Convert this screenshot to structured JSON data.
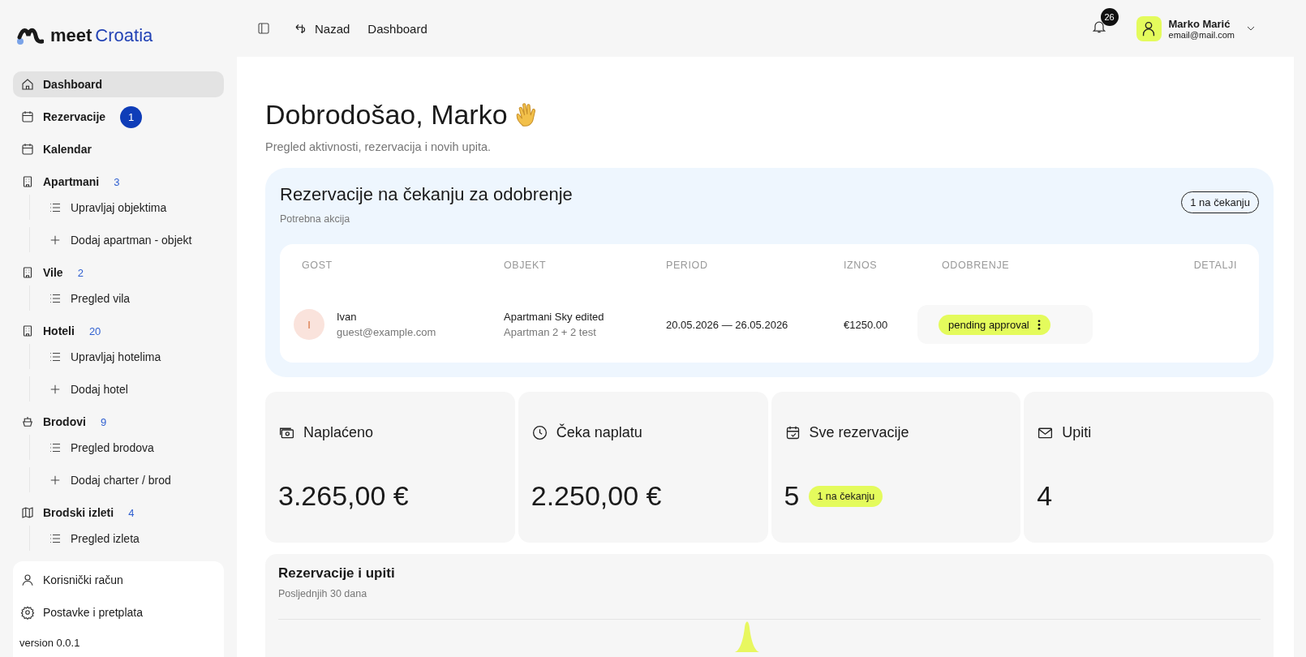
{
  "brand": {
    "mark": "meet",
    "name": "Croatia"
  },
  "sidebar": {
    "items": [
      {
        "label": "Dashboard",
        "selected": true
      },
      {
        "label": "Rezervacije",
        "selected": false,
        "badge": "1"
      },
      {
        "label": "Kalendar",
        "selected": false
      },
      {
        "label": "Apartmani",
        "selected": false,
        "count": "3",
        "children": [
          {
            "label": "Upravljaj objektima",
            "kind": "list"
          },
          {
            "label": "Dodaj apartman - objekt",
            "kind": "add"
          }
        ]
      },
      {
        "label": "Vile",
        "selected": false,
        "count": "2",
        "children": [
          {
            "label": "Pregled vila",
            "kind": "list"
          }
        ]
      },
      {
        "label": "Hoteli",
        "selected": false,
        "count": "20",
        "children": [
          {
            "label": "Upravljaj hotelima",
            "kind": "list"
          },
          {
            "label": "Dodaj hotel",
            "kind": "add"
          }
        ]
      },
      {
        "label": "Brodovi",
        "selected": false,
        "count": "9",
        "children": [
          {
            "label": "Pregled brodova",
            "kind": "list"
          },
          {
            "label": "Dodaj charter / brod",
            "kind": "add"
          }
        ]
      },
      {
        "label": "Brodski izleti",
        "selected": false,
        "count": "4",
        "children": [
          {
            "label": "Pregled izleta",
            "kind": "list"
          }
        ]
      }
    ]
  },
  "account_menu": {
    "items": [
      {
        "label": "Korisnički račun"
      },
      {
        "label": "Postavke i pretplata"
      }
    ],
    "version": "version 0.0.1"
  },
  "topbar": {
    "back": "Nazad",
    "breadcrumb": "Dashboard",
    "notifications": "26",
    "user": {
      "name": "Marko Marić",
      "email": "email@mail.com"
    }
  },
  "welcome": {
    "title": "Dobrodošao, Marko",
    "subtitle": "Pregled aktivnosti, rezervacija i novih upita."
  },
  "pending": {
    "title": "Rezervacije na čekanju za odobrenje",
    "subtitle": "Potrebna akcija",
    "badge": "1 na čekanju",
    "columns": [
      "GOST",
      "OBJEKT",
      "PERIOD",
      "IZNOS",
      "ODOBRENJE",
      "DETALJI"
    ],
    "rows": [
      {
        "initial": "I",
        "guest": "Ivan",
        "email": "guest@example.com",
        "object": "Apartmani Sky edited",
        "unit": "Apartman 2 + 2 test",
        "period": "20.05.2026 — 26.05.2026",
        "amount": "€1250.00",
        "status": "pending approval"
      }
    ]
  },
  "stats": [
    {
      "label": "Naplaćeno",
      "value": "3.265,00 €"
    },
    {
      "label": "Čeka naplatu",
      "value": "2.250,00 €"
    },
    {
      "label": "Sve rezervacije",
      "value": "5",
      "badge": "1 na čekanju"
    },
    {
      "label": "Upiti",
      "value": "4"
    }
  ],
  "activity": {
    "title": "Rezervacije i upiti",
    "subtitle": "Posljednjih 30 dana"
  }
}
